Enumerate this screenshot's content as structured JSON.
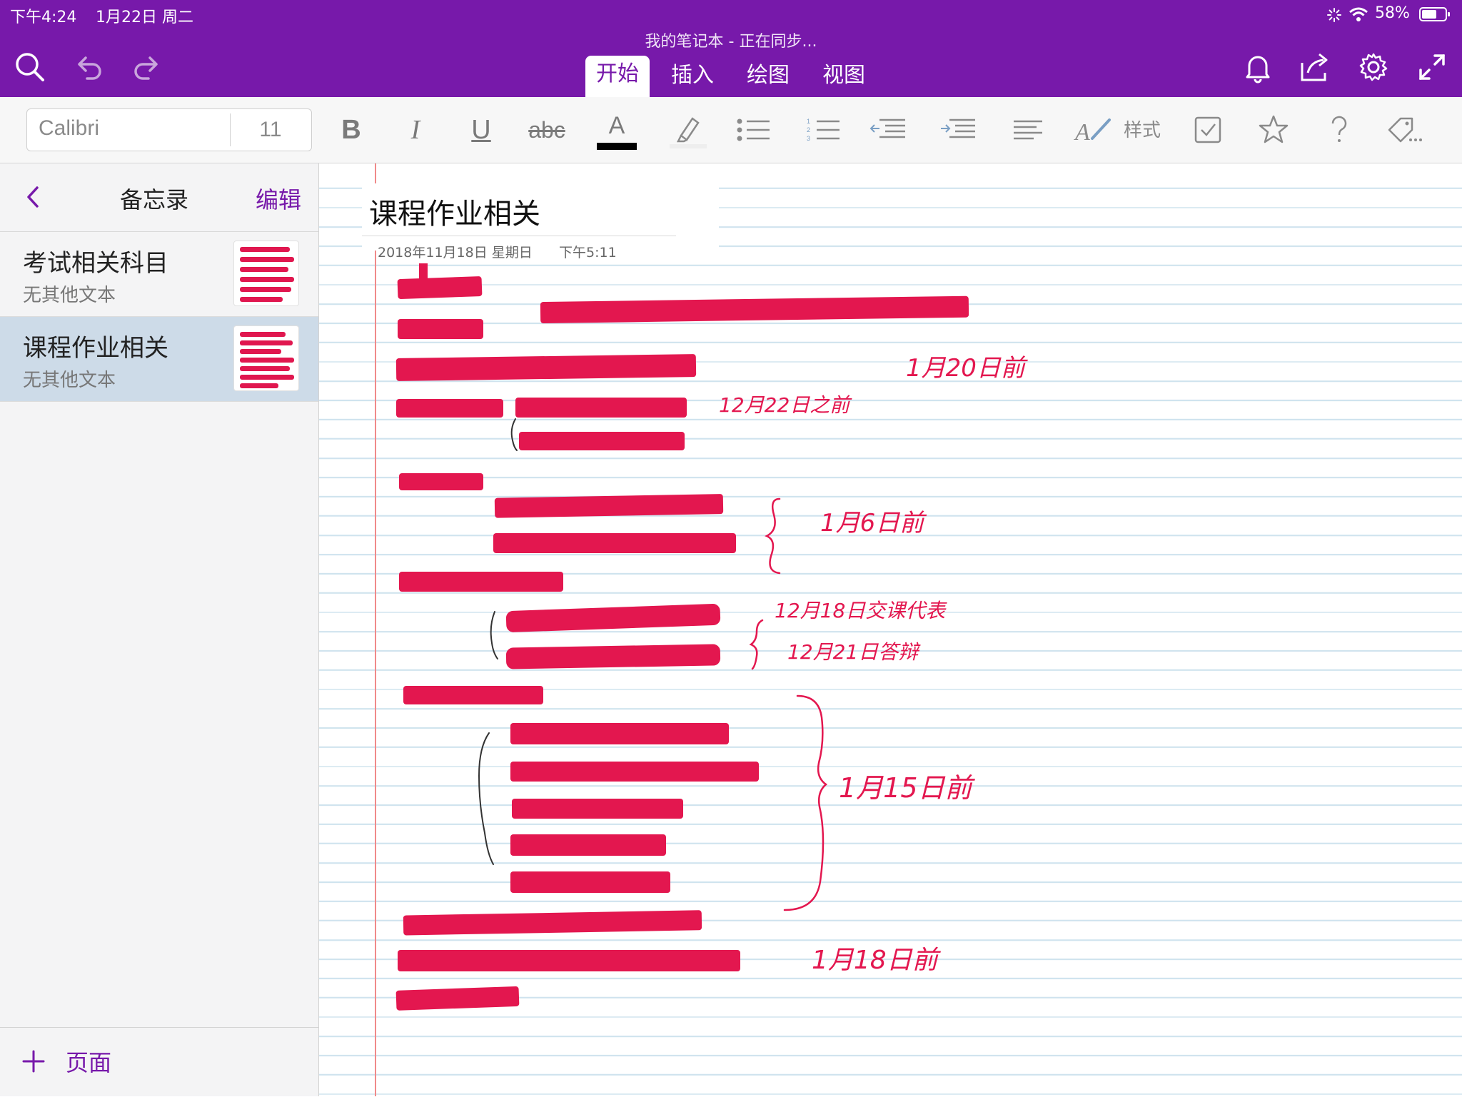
{
  "status_bar": {
    "time": "下午4:24",
    "date": "1月22日 周二",
    "battery": "58%"
  },
  "header": {
    "title": "我的笔记本 - 正在同步...",
    "tabs": [
      {
        "label": "开始",
        "active": true
      },
      {
        "label": "插入",
        "active": false
      },
      {
        "label": "绘图",
        "active": false
      },
      {
        "label": "视图",
        "active": false
      }
    ],
    "icons": [
      "search-icon",
      "undo-icon",
      "redo-icon",
      "bell-icon",
      "share-icon",
      "settings-icon",
      "expand-icon"
    ]
  },
  "ribbon": {
    "font_name": "Calibri",
    "font_size": "11",
    "bold": "B",
    "italic": "I",
    "underline": "U",
    "strikethrough": "abc",
    "font_color_letter": "A",
    "styles_label": "样式"
  },
  "sidebar": {
    "title": "备忘录",
    "edit_label": "编辑",
    "add_page_label": "页面",
    "pages": [
      {
        "title": "考试相关科目",
        "subtitle": "无其他文本",
        "selected": false
      },
      {
        "title": "课程作业相关",
        "subtitle": "无其他文本",
        "selected": true
      }
    ]
  },
  "note": {
    "title": "课程作业相关",
    "date": "2018年11月18日 星期日",
    "time": "下午5:11",
    "handwritten_annotations": [
      "1月20日前",
      "12月22日之前",
      "1月6日前",
      "12月18日交课代表",
      "12月21日答辩",
      "1月15日前",
      "1月18日前"
    ]
  },
  "colors": {
    "brand": "#7719aa",
    "ink_red": "#e3174f",
    "sidebar_selected": "#cddbe8"
  }
}
